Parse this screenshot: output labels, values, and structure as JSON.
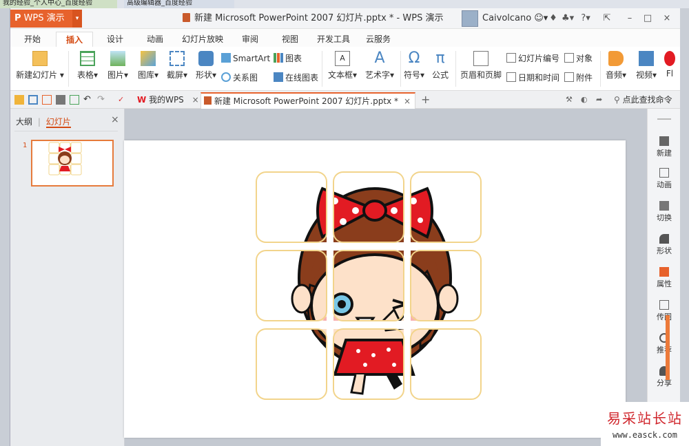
{
  "outer_tabs": [
    "我的经验_个人中心_百度经验",
    "高级编辑器_百度经验"
  ],
  "app": {
    "name": "WPS 演示",
    "dropdown": "▾"
  },
  "title": "新建 Microsoft PowerPoint 2007 幻灯片.pptx * - WPS 演示",
  "user": {
    "name": "Caivolcano"
  },
  "titlebar_icons": {
    "help": "?"
  },
  "ribbon_tabs": [
    "开始",
    "插入",
    "设计",
    "动画",
    "幻灯片放映",
    "审阅",
    "视图",
    "开发工具",
    "云服务"
  ],
  "active_tab": "插入",
  "ribbon": {
    "new_slide": "新建幻灯片",
    "table": "表格",
    "picture": "图片",
    "gallery": "图库",
    "screenshot": "截屏",
    "shape": "形状",
    "smartart": "SmartArt",
    "chart": "图表",
    "relation": "关系图",
    "online_chart": "在线图表",
    "textbox": "文本框",
    "wordart": "艺术字",
    "symbol": "符号",
    "formula": "公式",
    "header_footer": "页眉和页脚",
    "slide_number": "幻灯片编号",
    "object": "对象",
    "datetime": "日期和时间",
    "attachment": "附件",
    "audio": "音频",
    "video": "视频",
    "flash": "Fl"
  },
  "doc_tabs": [
    {
      "label": "我的WPS",
      "close": "×"
    },
    {
      "label": "新建 Microsoft PowerPoint 2007 幻灯片.pptx *",
      "close": "×"
    }
  ],
  "new_tab": "+",
  "search_command": "点此查找命令",
  "left_panel": {
    "tab_outline": "大纲",
    "divider": "|",
    "tab_slides": "幻灯片",
    "close": "×",
    "slide_number": "1"
  },
  "right_sidebar": [
    "新建",
    "动画",
    "切换",
    "形状",
    "属性",
    "传图",
    "推荐",
    "分享"
  ],
  "watermark": {
    "text1": "易采站长站",
    "text2": "www.easck.com"
  },
  "colors": {
    "accent": "#e7622c",
    "grid_border": "#f2d48b",
    "bow_red": "#e21b23",
    "hair_brown": "#8a3d1c",
    "skin": "#fde1c9"
  }
}
